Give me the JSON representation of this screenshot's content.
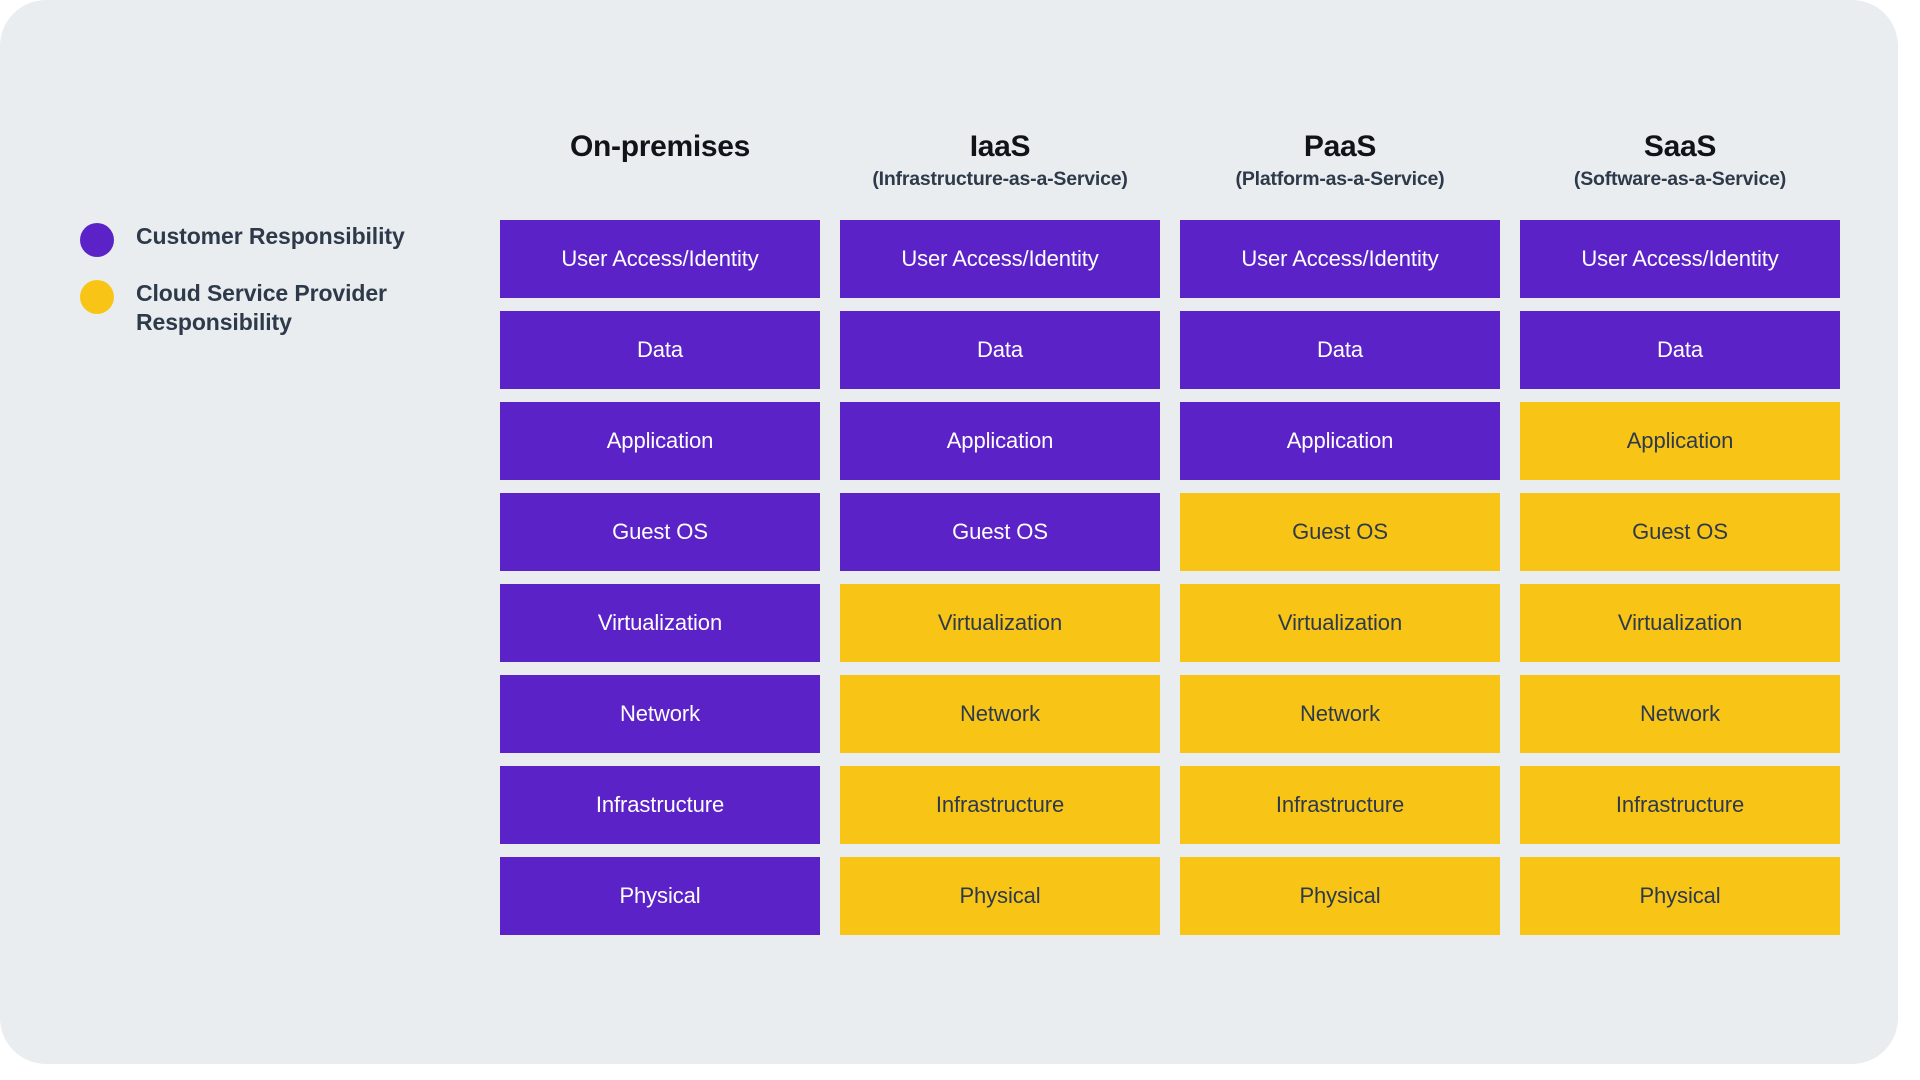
{
  "theme": {
    "page_background": "#ffffff",
    "card_background": "#e9edef",
    "customer_color": "#5b22c8",
    "provider_color": "#f8c517",
    "customer_text_color": "#ffffff",
    "provider_text_color": "#2e3a4a",
    "heading_color": "#12121a",
    "subheading_color": "#2e3a4a"
  },
  "legend": {
    "items": [
      {
        "label": "Customer Responsibility",
        "color": "#5b22c8",
        "key": "customer"
      },
      {
        "label": "Cloud Service Provider Responsibility",
        "color": "#f8c517",
        "key": "provider"
      }
    ]
  },
  "chart_data": {
    "type": "table",
    "title": "",
    "legend_position": "left",
    "categories": [
      "On-premises",
      "IaaS",
      "PaaS",
      "SaaS"
    ],
    "layers": [
      "User Access/Identity",
      "Data",
      "Application",
      "Guest OS",
      "Virtualization",
      "Network",
      "Infrastructure",
      "Physical"
    ],
    "columns": [
      {
        "title": "On-premises",
        "subtitle": "",
        "cells": [
          {
            "label": "User Access/Identity",
            "owner": "customer"
          },
          {
            "label": "Data",
            "owner": "customer"
          },
          {
            "label": "Application",
            "owner": "customer"
          },
          {
            "label": "Guest OS",
            "owner": "customer"
          },
          {
            "label": "Virtualization",
            "owner": "customer"
          },
          {
            "label": "Network",
            "owner": "customer"
          },
          {
            "label": "Infrastructure",
            "owner": "customer"
          },
          {
            "label": "Physical",
            "owner": "customer"
          }
        ]
      },
      {
        "title": "IaaS",
        "subtitle": "(Infrastructure-as-a-Service)",
        "cells": [
          {
            "label": "User Access/Identity",
            "owner": "customer"
          },
          {
            "label": "Data",
            "owner": "customer"
          },
          {
            "label": "Application",
            "owner": "customer"
          },
          {
            "label": "Guest OS",
            "owner": "customer"
          },
          {
            "label": "Virtualization",
            "owner": "provider"
          },
          {
            "label": "Network",
            "owner": "provider"
          },
          {
            "label": "Infrastructure",
            "owner": "provider"
          },
          {
            "label": "Physical",
            "owner": "provider"
          }
        ]
      },
      {
        "title": "PaaS",
        "subtitle": "(Platform-as-a-Service)",
        "cells": [
          {
            "label": "User Access/Identity",
            "owner": "customer"
          },
          {
            "label": "Data",
            "owner": "customer"
          },
          {
            "label": "Application",
            "owner": "customer"
          },
          {
            "label": "Guest OS",
            "owner": "provider"
          },
          {
            "label": "Virtualization",
            "owner": "provider"
          },
          {
            "label": "Network",
            "owner": "provider"
          },
          {
            "label": "Infrastructure",
            "owner": "provider"
          },
          {
            "label": "Physical",
            "owner": "provider"
          }
        ]
      },
      {
        "title": "SaaS",
        "subtitle": "(Software-as-a-Service)",
        "cells": [
          {
            "label": "User Access/Identity",
            "owner": "customer"
          },
          {
            "label": "Data",
            "owner": "customer"
          },
          {
            "label": "Application",
            "owner": "provider"
          },
          {
            "label": "Guest OS",
            "owner": "provider"
          },
          {
            "label": "Virtualization",
            "owner": "provider"
          },
          {
            "label": "Network",
            "owner": "provider"
          },
          {
            "label": "Infrastructure",
            "owner": "provider"
          },
          {
            "label": "Physical",
            "owner": "provider"
          }
        ]
      }
    ]
  }
}
